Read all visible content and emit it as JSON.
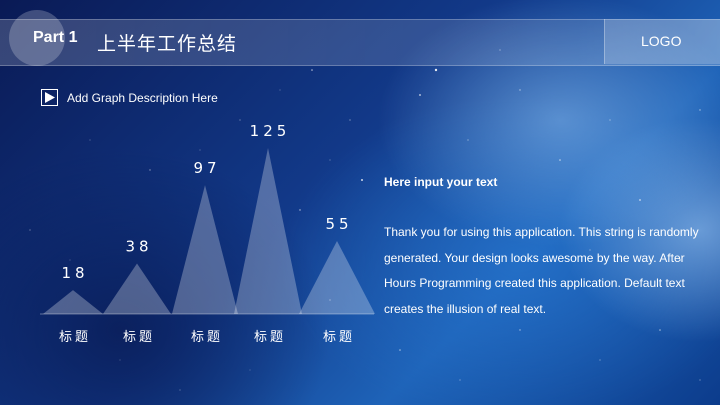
{
  "header": {
    "part_label": "Part 1",
    "title": "上半年工作总结",
    "logo": "LOGO"
  },
  "description": {
    "icon": "play-square-icon",
    "text": "Add Graph Description Here"
  },
  "info": {
    "title": "Here input your text",
    "body": "Thank you for using this application. This string is randomly generated. Your design looks awesome by the way. After Hours Programming created this application. Default text creates the illusion of real text."
  },
  "chart_data": {
    "type": "bar",
    "categories": [
      "标题",
      "标题",
      "标题",
      "标题",
      "标题"
    ],
    "values": [
      18,
      38,
      97,
      125,
      55
    ],
    "value_labels": [
      "18",
      "38",
      "97",
      "125",
      "55"
    ],
    "ylim": [
      0,
      125
    ],
    "grid": false,
    "colors": {
      "fill": "#ffffff",
      "baseline": "#ffffff"
    }
  }
}
